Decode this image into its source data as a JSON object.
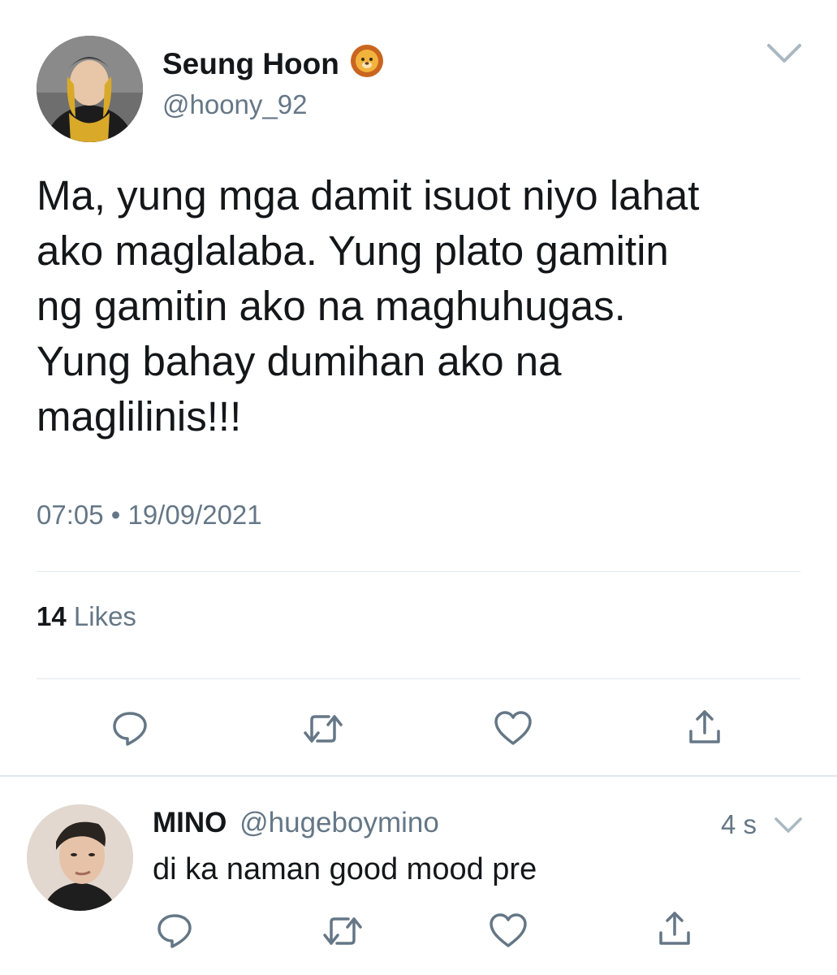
{
  "tweet": {
    "display_name": "Seung Hoon",
    "name_emoji": "🦁",
    "handle": "@hoony_92",
    "text": "Ma, yung mga damit isuot niyo lahat\nako maglalaba. Yung plato gamitin\nng gamitin ako na maghuhugas.\nYung bahay dumihan ako na\nmaglilinis!!!",
    "timestamp": "07:05 • 19/09/2021",
    "likes_count": "14",
    "likes_label": "Likes"
  },
  "reply": {
    "display_name": "MINO",
    "handle": "@hugeboymino",
    "time": "4 s",
    "text": "di ka naman good mood pre"
  },
  "icons": {
    "menu": "chevron-down-icon",
    "reply": "reply-bubble-icon",
    "retweet": "retweet-icon",
    "like": "heart-icon",
    "share": "share-icon"
  },
  "colors": {
    "icon": "#657786",
    "text": "#14171a",
    "secondary_text": "#657786",
    "divider": "#e1e8ed"
  }
}
